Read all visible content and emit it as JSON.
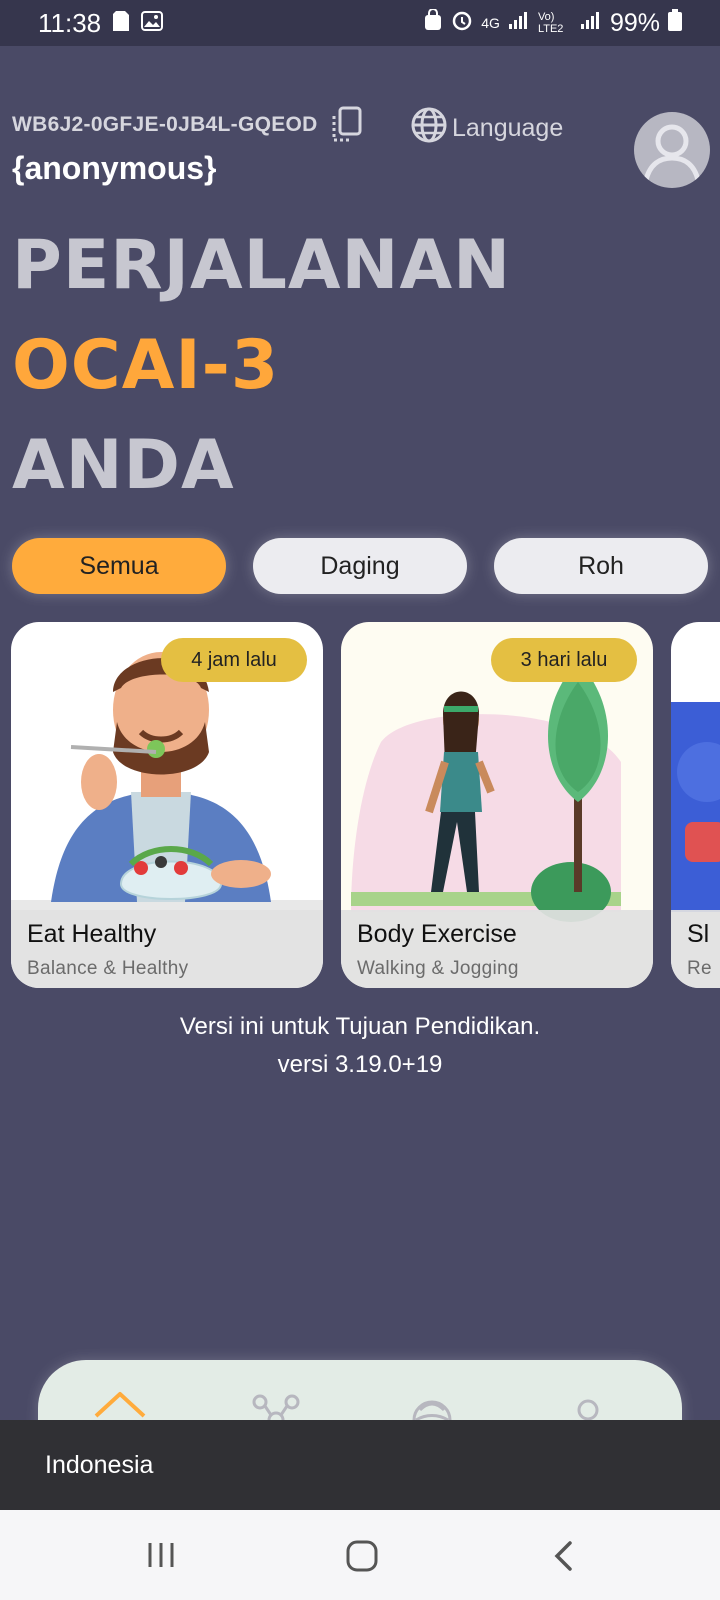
{
  "status_bar": {
    "time": "11:38",
    "network": "4G",
    "volte": "Vo) LTE2",
    "battery": "99%"
  },
  "header": {
    "device_id": "WB6J2-0GFJE-0JB4L-GQEOD",
    "language_label": "Language",
    "username": "{anonymous}"
  },
  "headline": {
    "line1": "PERJALANAN",
    "line2": "OCAI-3",
    "line3": "ANDA"
  },
  "filters": [
    {
      "label": "Semua",
      "selected": true
    },
    {
      "label": "Daging",
      "selected": false
    },
    {
      "label": "Roh",
      "selected": false
    }
  ],
  "cards": [
    {
      "title": "Eat Healthy",
      "subtitle": "Balance & Healthy",
      "badge": "4 jam lalu"
    },
    {
      "title": "Body Exercise",
      "subtitle": "Walking & Jogging",
      "badge": "3 hari lalu"
    },
    {
      "title": "Sl",
      "subtitle": "Re"
    }
  ],
  "footer_note": {
    "line1": "Versi ini untuk Tujuan Pendidikan.",
    "line2": "versi 3.19.0+19"
  },
  "snackbar": {
    "text": "Indonesia"
  },
  "colors": {
    "background": "#4a4a66",
    "accent": "#ffa73b",
    "badge": "#e4bf42",
    "chip_inactive": "#ececf0"
  },
  "icons": {
    "copy": "copy-icon",
    "language": "globe-icon",
    "avatar": "user-avatar-icon",
    "nav": [
      "home-icon",
      "network-icon",
      "ai-icon",
      "profile-icon"
    ]
  }
}
